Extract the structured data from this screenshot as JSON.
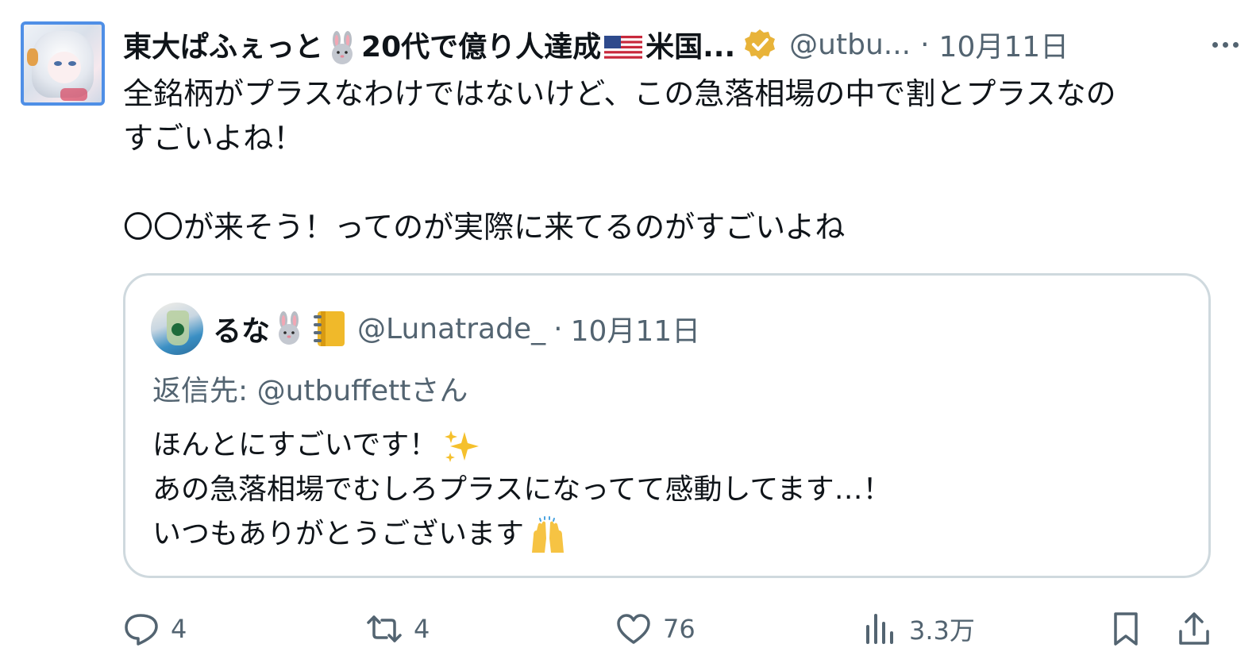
{
  "tweet": {
    "display_name_part1": "東大ぱふぇっと",
    "display_name_part2": "20代で億り人達成",
    "display_name_part3": "米国...",
    "handle": "@utbu...",
    "separator": "·",
    "date": "10月11日",
    "text_lines": [
      "全銘柄がプラスなわけではないけど、この急落相場の中で割とプラスなの",
      "すごいよね！",
      "",
      "〇〇が来そう！ってのが実際に来てるのがすごいよね"
    ]
  },
  "quote": {
    "name": "るな",
    "handle": "@Lunatrade_",
    "separator": "·",
    "date": "10月11日",
    "reply_prefix": "返信先: ",
    "reply_mention": "@utbuffettさん",
    "text_lines": [
      "ほんとにすごいです！",
      "あの急落相場でむしろプラスになってて感動してます…！",
      "いつもありがとうございます"
    ]
  },
  "actions": {
    "reply_count": "4",
    "retweet_count": "4",
    "like_count": "76",
    "views_count": "3.3万"
  },
  "icons": {
    "reply": "reply-icon",
    "retweet": "retweet-icon",
    "like": "heart-icon",
    "views": "views-icon",
    "bookmark": "bookmark-icon",
    "share": "share-icon",
    "verified": "verified-badge-icon",
    "more": "more-icon"
  },
  "colors": {
    "text": "#0f1419",
    "secondary": "#536471",
    "border": "#cfd9de",
    "verified": "#e8b339",
    "avatar_border": "#4f8fe6"
  }
}
